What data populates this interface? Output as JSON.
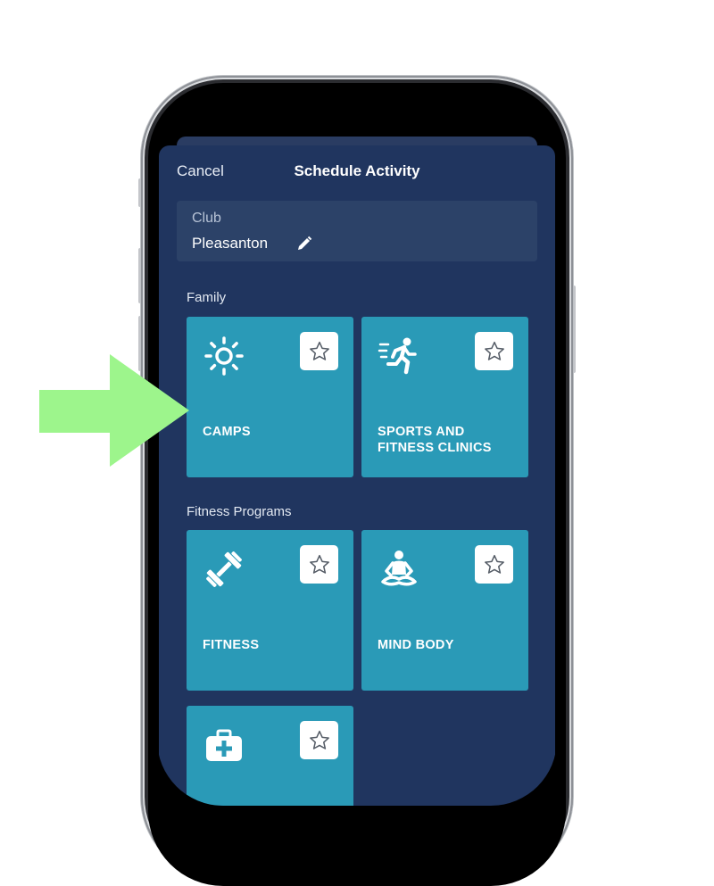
{
  "header": {
    "cancel_label": "Cancel",
    "title": "Schedule Activity"
  },
  "club": {
    "label": "Club",
    "value": "Pleasanton"
  },
  "sections": [
    {
      "label": "Family",
      "tiles": [
        {
          "lines": [
            "CAMPS"
          ],
          "icon": "sun-icon"
        },
        {
          "lines": [
            "SPORTS AND",
            "FITNESS CLINICS"
          ],
          "icon": "running-person-icon"
        }
      ]
    },
    {
      "label": "Fitness Programs",
      "tiles": [
        {
          "lines": [
            "FITNESS"
          ],
          "icon": "dumbbell-icon"
        },
        {
          "lines": [
            "MIND BODY"
          ],
          "icon": "meditation-icon"
        },
        {
          "lines": [],
          "icon": "first-aid-kit-icon"
        }
      ]
    }
  ],
  "colors": {
    "sheet_background": "#20355f",
    "tile_background": "#2a9ab7",
    "club_field_background": "#2c4268",
    "arrow_highlight": "#9df58c"
  }
}
